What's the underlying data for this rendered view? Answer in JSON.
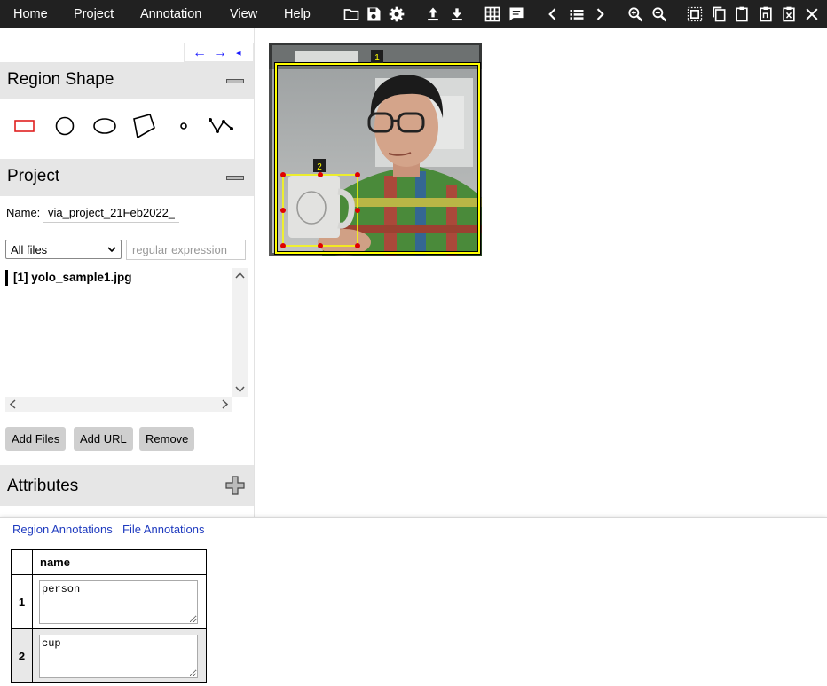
{
  "menu": {
    "home": "Home",
    "project": "Project",
    "annotation": "Annotation",
    "view": "View",
    "help": "Help"
  },
  "toolbar_icons": [
    "folder-icon",
    "save-icon",
    "gear-icon",
    "upload-icon",
    "download-icon",
    "grid-icon",
    "comment-icon",
    "chevron-left-icon",
    "list-icon",
    "chevron-right-icon",
    "zoom-in-icon",
    "zoom-out-icon",
    "select-all-icon",
    "copy-icon",
    "paste-icon",
    "paste-n-icon",
    "delete-clipboard-icon",
    "close-icon"
  ],
  "nav": {
    "prev": "←",
    "next": "→",
    "collapse": "◂"
  },
  "region_shape": {
    "title": "Region Shape",
    "shapes": [
      "rectangle",
      "circle",
      "ellipse",
      "polygon",
      "point",
      "polyline"
    ],
    "selected": "rectangle",
    "selected_color": "#e0201f"
  },
  "project": {
    "title": "Project",
    "name_label": "Name:",
    "name_value": "via_project_21Feb2022_",
    "filter_selected": "All files",
    "regex_placeholder": "regular expression",
    "files": [
      {
        "label": "[1] yolo_sample1.jpg"
      }
    ],
    "buttons": {
      "add_files": "Add Files",
      "add_url": "Add URL",
      "remove": "Remove"
    }
  },
  "attributes": {
    "title": "Attributes"
  },
  "canvas": {
    "regions": [
      {
        "id": "1"
      },
      {
        "id": "2"
      }
    ],
    "region_color": "#ffff00",
    "handle_color": "#e00000"
  },
  "bottom": {
    "tabs": [
      {
        "label": "Region Annotations",
        "active": true
      },
      {
        "label": "File Annotations",
        "active": false
      }
    ],
    "table": {
      "header": "name",
      "rows": [
        {
          "index": "1",
          "name": "person"
        },
        {
          "index": "2",
          "name": "cup"
        }
      ]
    }
  }
}
